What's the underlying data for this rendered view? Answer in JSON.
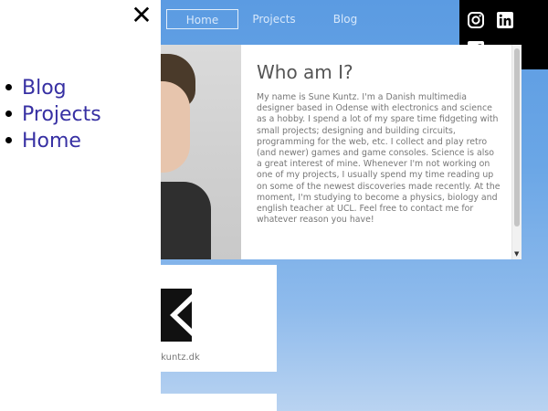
{
  "topnav": {
    "items": [
      {
        "label": "Home",
        "active": true
      },
      {
        "label": "Projects"
      },
      {
        "label": "Blog"
      }
    ]
  },
  "social": {
    "icons": [
      "instagram-icon",
      "linkedin-icon",
      "facebook-icon"
    ],
    "background": "#000000"
  },
  "about": {
    "title": "Who am I?",
    "text": "My name is Sune Kuntz. I'm a Danish multimedia designer based in Odense with electronics and science as a hobby. I spend a lot of my spare time fidgeting with small projects; designing and building circuits, programming for the web, etc. I collect and play retro (and newer) games and game consoles. Science is also a great interest of mine. Whenever I'm not working on one of my projects, I usually spend my time reading up on some of the newest discoveries made recently. At the moment, I'm studying to become a physics, biology and english teacher at UCL. Feel free to contact me for whatever reason you have!"
  },
  "projects": {
    "card1_caption": "ekuntz.dk"
  },
  "side_menu": {
    "close_label": "✕",
    "items": [
      {
        "label": "Blog"
      },
      {
        "label": "Projects"
      },
      {
        "label": "Home"
      }
    ],
    "link_color": "#3730a3"
  },
  "colors": {
    "background_top": "#5b9be2",
    "background_bottom": "#b9d3f1"
  }
}
